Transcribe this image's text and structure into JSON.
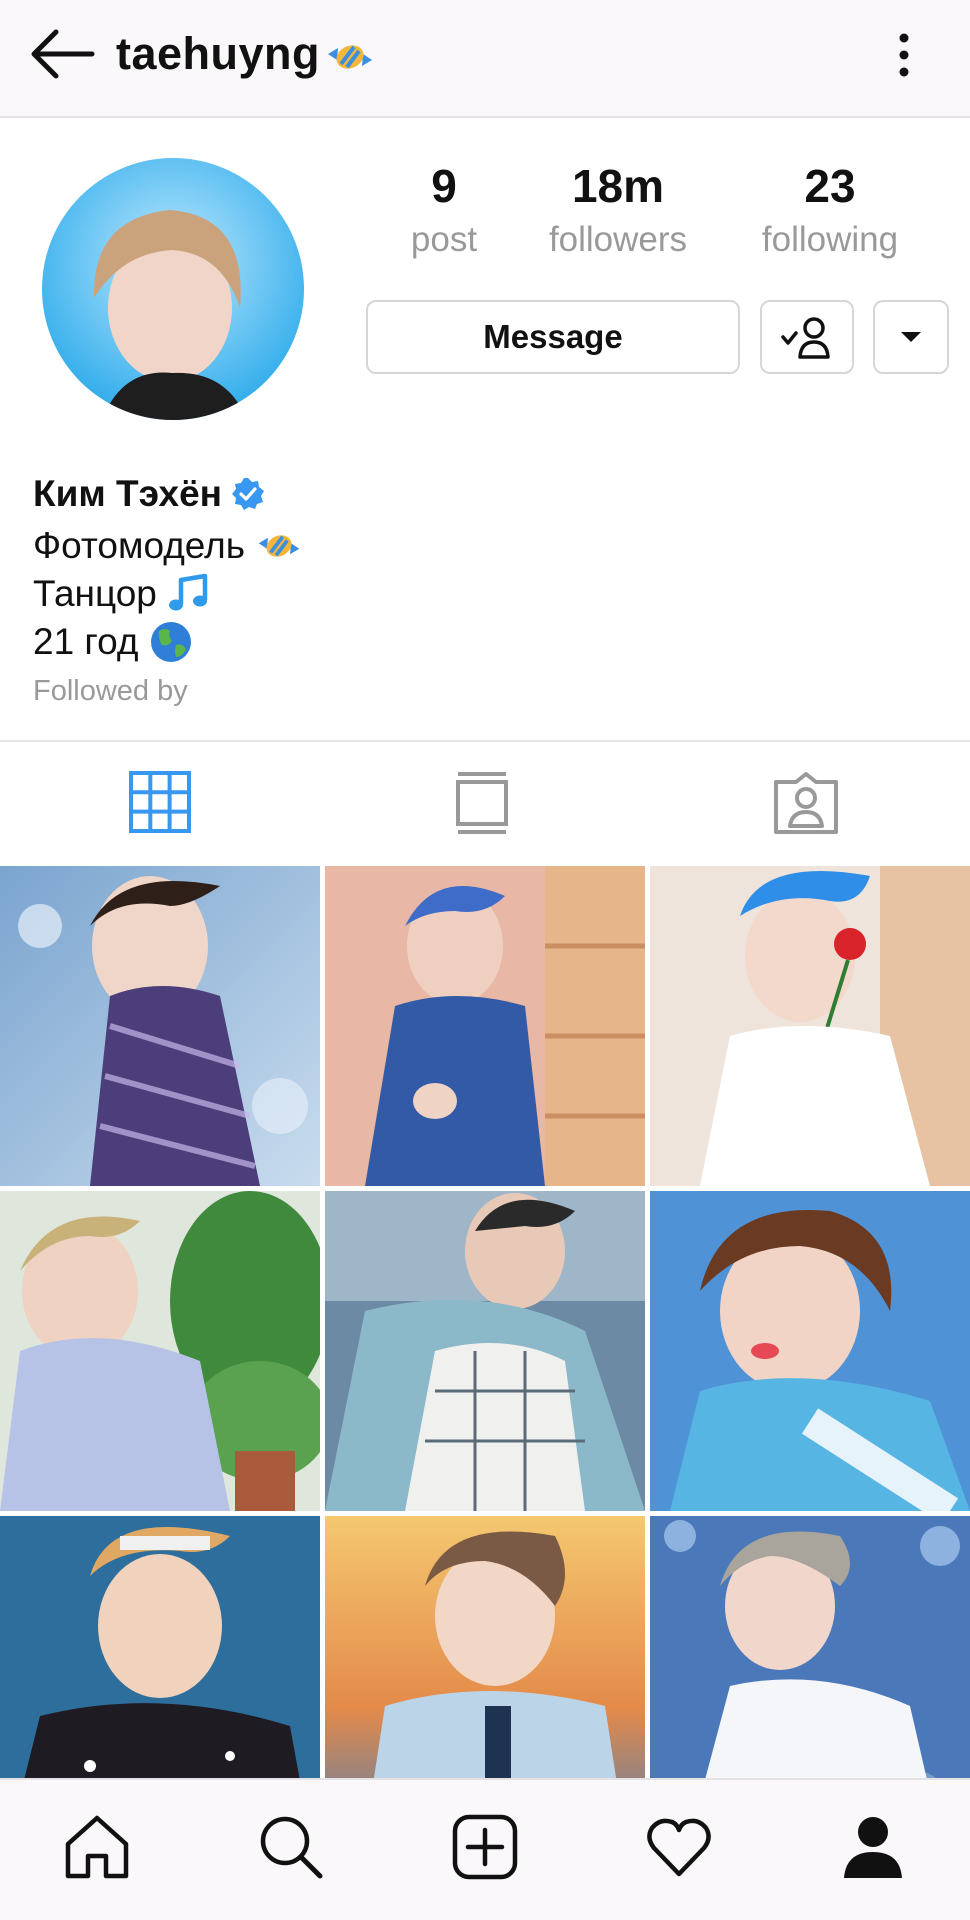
{
  "header": {
    "username": "taehuyng",
    "back_icon": "arrow-left-icon",
    "more_icon": "more-vertical-icon",
    "title_emoji": "candy-icon"
  },
  "stats": [
    {
      "value": "9",
      "label": "post"
    },
    {
      "value": "18m",
      "label": "followers"
    },
    {
      "value": "23",
      "label": "following"
    }
  ],
  "actions": {
    "message_label": "Message",
    "follow_icon": "user-check-icon",
    "dropdown_icon": "caret-down-icon"
  },
  "bio": {
    "name": "Ким Тэхён",
    "verified_icon": "verified-badge-icon",
    "lines": [
      {
        "text": "Фотомодель",
        "emoji": "candy-icon"
      },
      {
        "text": "Танцор",
        "emoji": "music-note-icon"
      },
      {
        "text": "21 год",
        "emoji": "globe-icon"
      }
    ],
    "followed_by": "Followed by"
  },
  "tabs": [
    {
      "name": "grid",
      "icon": "grid-icon",
      "active": true
    },
    {
      "name": "feed",
      "icon": "feed-icon",
      "active": false
    },
    {
      "name": "tagged",
      "icon": "tagged-person-icon",
      "active": false
    }
  ],
  "colors": {
    "accent": "#3897f0",
    "muted_text": "#999999",
    "bar_bg": "#faf8fa",
    "border": "#d6d6d6"
  },
  "bottom_nav": [
    {
      "name": "home",
      "icon": "home-icon"
    },
    {
      "name": "search",
      "icon": "search-icon"
    },
    {
      "name": "new-post",
      "icon": "plus-square-icon"
    },
    {
      "name": "activity",
      "icon": "heart-icon"
    },
    {
      "name": "profile",
      "icon": "profile-icon"
    }
  ]
}
